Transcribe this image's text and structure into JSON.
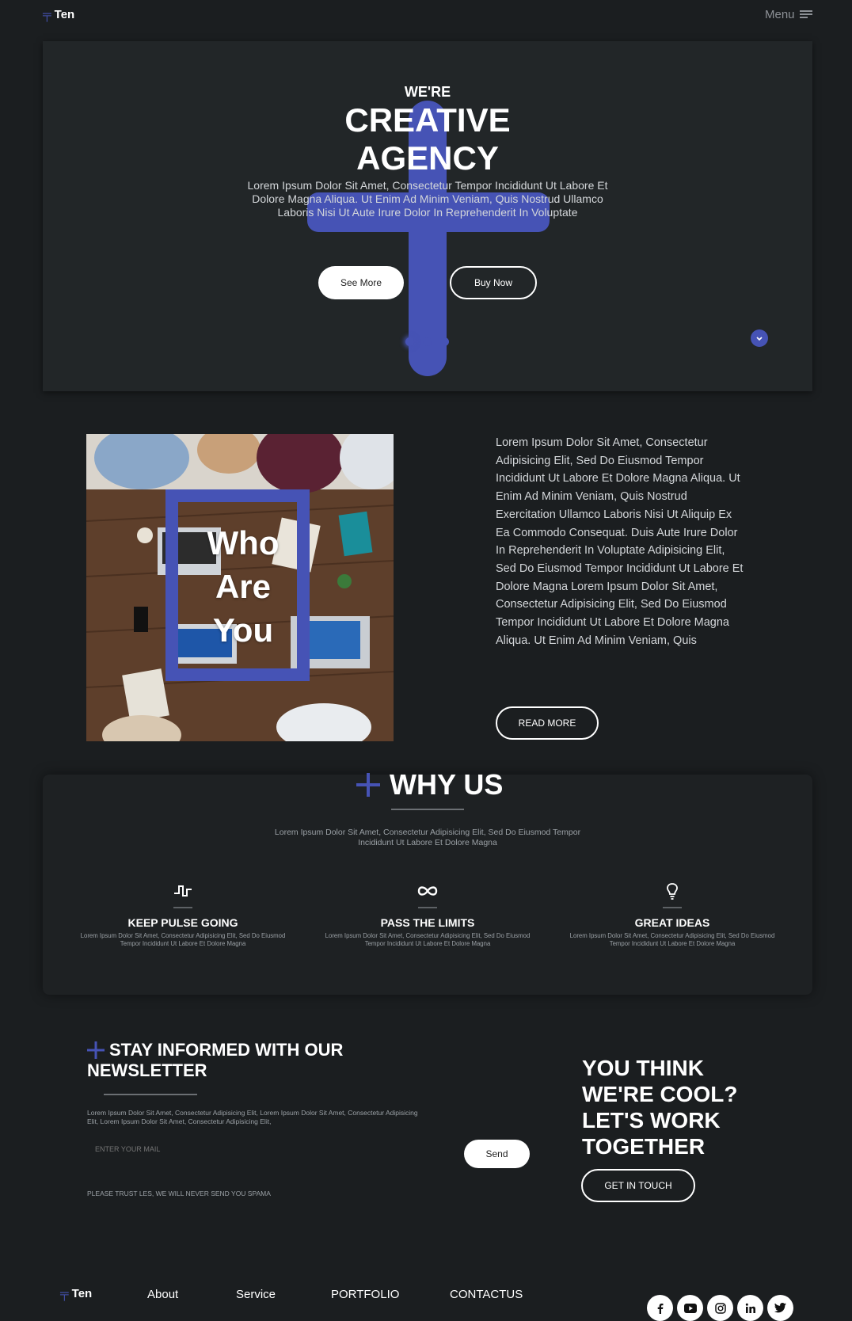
{
  "brand": {
    "logo": "Ten",
    "logo_color": "#4653b5"
  },
  "nav": {
    "menu_label": "Menu"
  },
  "hero": {
    "pre_title": "WE'RE",
    "title_line1": "CREATIVE",
    "title_line2": "AGENCY",
    "description": "Lorem Ipsum Dolor Sit Amet, Consectetur Tempor Incididunt Ut Labore Et Dolore Magna Aliqua. Ut Enim Ad Minim Veniam, Quis Nostrud Ullamco Laboris Nisi Ut Aute Irure Dolor In Reprehenderit In Voluptate",
    "see_more_label": "See More",
    "buy_now_label": "Buy Now",
    "slides": 3,
    "active_slide": 1
  },
  "who": {
    "overlay_line1": "Who",
    "overlay_line2": "Are",
    "overlay_line3": "You",
    "paragraph": "Lorem Ipsum Dolor Sit Amet, Consectetur Adipisicing Elit, Sed Do Eiusmod Tempor Incididunt Ut Labore Et Dolore Magna Aliqua. Ut Enim Ad Minim Veniam, Quis Nostrud Exercitation Ullamco Laboris Nisi Ut Aliquip Ex Ea Commodo Consequat. Duis Aute Irure Dolor In Reprehenderit In Voluptate Adipisicing Elit, Sed Do Eiusmod Tempor Incididunt Ut Labore Et Dolore Magna Lorem Ipsum Dolor Sit Amet, Consectetur Adipisicing Elit, Sed Do Eiusmod Tempor Incididunt Ut Labore Et Dolore Magna Aliqua. Ut Enim Ad Minim Veniam, Quis",
    "read_more_label": "READ MORE"
  },
  "why": {
    "title": "WHY US",
    "description": "Lorem Ipsum Dolor Sit Amet, Consectetur Adipisicing Elit, Sed Do Eiusmod Tempor Incididunt Ut Labore Et Dolore Magna",
    "features": [
      {
        "icon": "pulse-icon",
        "title": "KEEP PULSE GOING",
        "text": "Lorem Ipsum Dolor Sit Amet, Consectetur Adipisicing Elit, Sed Do Eiusmod Tempor Incididunt Ut Labore Et Dolore Magna"
      },
      {
        "icon": "infinity-icon",
        "title": "PASS THE LIMITS",
        "text": "Lorem Ipsum Dolor Sit Amet, Consectetur Adipisicing Elit, Sed Do Eiusmod Tempor Incididunt Ut Labore Et Dolore Magna"
      },
      {
        "icon": "lightbulb-icon",
        "title": "GREAT IDEAS",
        "text": "Lorem Ipsum Dolor Sit Amet, Consectetur Adipisicing Elit, Sed Do Eiusmod Tempor Incididunt Ut Labore Et Dolore Magna"
      }
    ]
  },
  "newsletter": {
    "title_line1": "STAY INFORMED WITH OUR",
    "title_line2": "NEWSLETTER",
    "description": "Lorem Ipsum Dolor Sit Amet, Consectetur Adipisicing Elit, Lorem Ipsum Dolor Sit Amet, Consectetur Adipisicing Elit, Lorem Ipsum Dolor Sit Amet, Consectetur Adipisicing Elit,",
    "email_placeholder": "ENTER YOUR MAIL",
    "send_label": "Send",
    "disclaimer": "PLEASE TRUST LES, WE WILL NEVER SEND YOU SPAMA"
  },
  "cta": {
    "line1": "YOU THINK",
    "line2": "WE'RE COOL?",
    "line3": "LET'S WORK",
    "line4": "TOGETHER",
    "button_label": "GET IN TOUCH"
  },
  "footer": {
    "logo": "Ten",
    "links": [
      "About",
      "Service",
      "PORTFOLIO",
      "CONTACTUS"
    ],
    "social_icons": [
      "facebook-icon",
      "youtube-icon",
      "instagram-icon",
      "linkedin-icon",
      "twitter-icon"
    ]
  }
}
